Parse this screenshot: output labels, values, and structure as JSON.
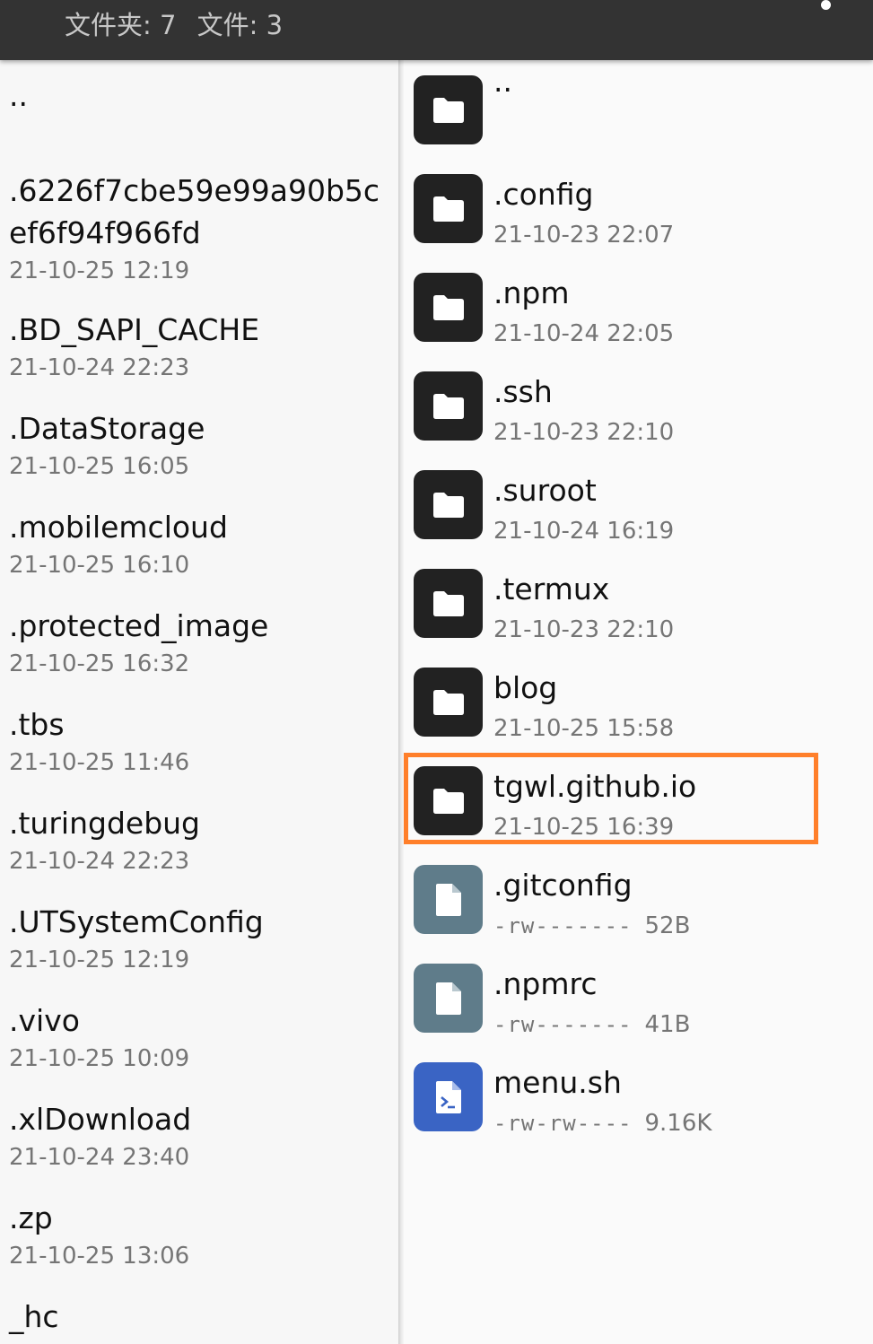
{
  "header": {
    "folders_label": "文件夹: 7",
    "files_label": "文件: 3"
  },
  "left_list": [
    {
      "name": "..",
      "date": ""
    },
    {
      "name": ".6226f7cbe59e99a90b5cef6f94f966fd",
      "date": "21-10-25 12:19"
    },
    {
      "name": ".BD_SAPI_CACHE",
      "date": "21-10-24 22:23"
    },
    {
      "name": ".DataStorage",
      "date": "21-10-25 16:05"
    },
    {
      "name": ".mobilemcloud",
      "date": "21-10-25 16:10"
    },
    {
      "name": ".protected_image",
      "date": "21-10-25 16:32"
    },
    {
      "name": ".tbs",
      "date": "21-10-25 11:46"
    },
    {
      "name": ".turingdebug",
      "date": "21-10-24 22:23"
    },
    {
      "name": ".UTSystemConfig",
      "date": "21-10-25 12:19"
    },
    {
      "name": ".vivo",
      "date": "21-10-25 10:09"
    },
    {
      "name": ".xlDownload",
      "date": "21-10-24 23:40"
    },
    {
      "name": ".zp",
      "date": "21-10-25 13:06"
    },
    {
      "name": "_hc",
      "date": ""
    }
  ],
  "right_list": [
    {
      "name": "..",
      "kind": "folder",
      "icon": "folder-icon",
      "date": "",
      "perm": "",
      "size": ""
    },
    {
      "name": ".config",
      "kind": "folder",
      "icon": "folder-icon",
      "date": "21-10-23 22:07",
      "perm": "",
      "size": ""
    },
    {
      "name": ".npm",
      "kind": "folder",
      "icon": "folder-icon",
      "date": "21-10-24 22:05",
      "perm": "",
      "size": ""
    },
    {
      "name": ".ssh",
      "kind": "folder",
      "icon": "folder-icon",
      "date": "21-10-23 22:10",
      "perm": "",
      "size": ""
    },
    {
      "name": ".suroot",
      "kind": "folder",
      "icon": "folder-icon",
      "date": "21-10-24 16:19",
      "perm": "",
      "size": ""
    },
    {
      "name": ".termux",
      "kind": "folder",
      "icon": "folder-icon",
      "date": "21-10-23 22:10",
      "perm": "",
      "size": ""
    },
    {
      "name": "blog",
      "kind": "folder",
      "icon": "folder-icon",
      "date": "21-10-25 15:58",
      "perm": "",
      "size": ""
    },
    {
      "name": "tgwl.github.io",
      "kind": "folder",
      "icon": "folder-icon",
      "date": "21-10-25 16:39",
      "perm": "",
      "size": "",
      "selected": true
    },
    {
      "name": ".gitconfig",
      "kind": "file",
      "icon": "file-icon",
      "date": "",
      "perm": "-rw-------",
      "size": "52B"
    },
    {
      "name": ".npmrc",
      "kind": "file",
      "icon": "file-icon",
      "date": "",
      "perm": "-rw-------",
      "size": "41B"
    },
    {
      "name": "menu.sh",
      "kind": "script",
      "icon": "script-file-icon",
      "date": "",
      "perm": "-rw-rw----",
      "size": "9.16K"
    }
  ],
  "colors": {
    "header_bg": "#333333",
    "folder_icon_bg": "#222222",
    "file_icon_bg": "#5f7c8a",
    "script_icon_bg": "#3a64c4",
    "selection_border": "#ff7f2a"
  }
}
